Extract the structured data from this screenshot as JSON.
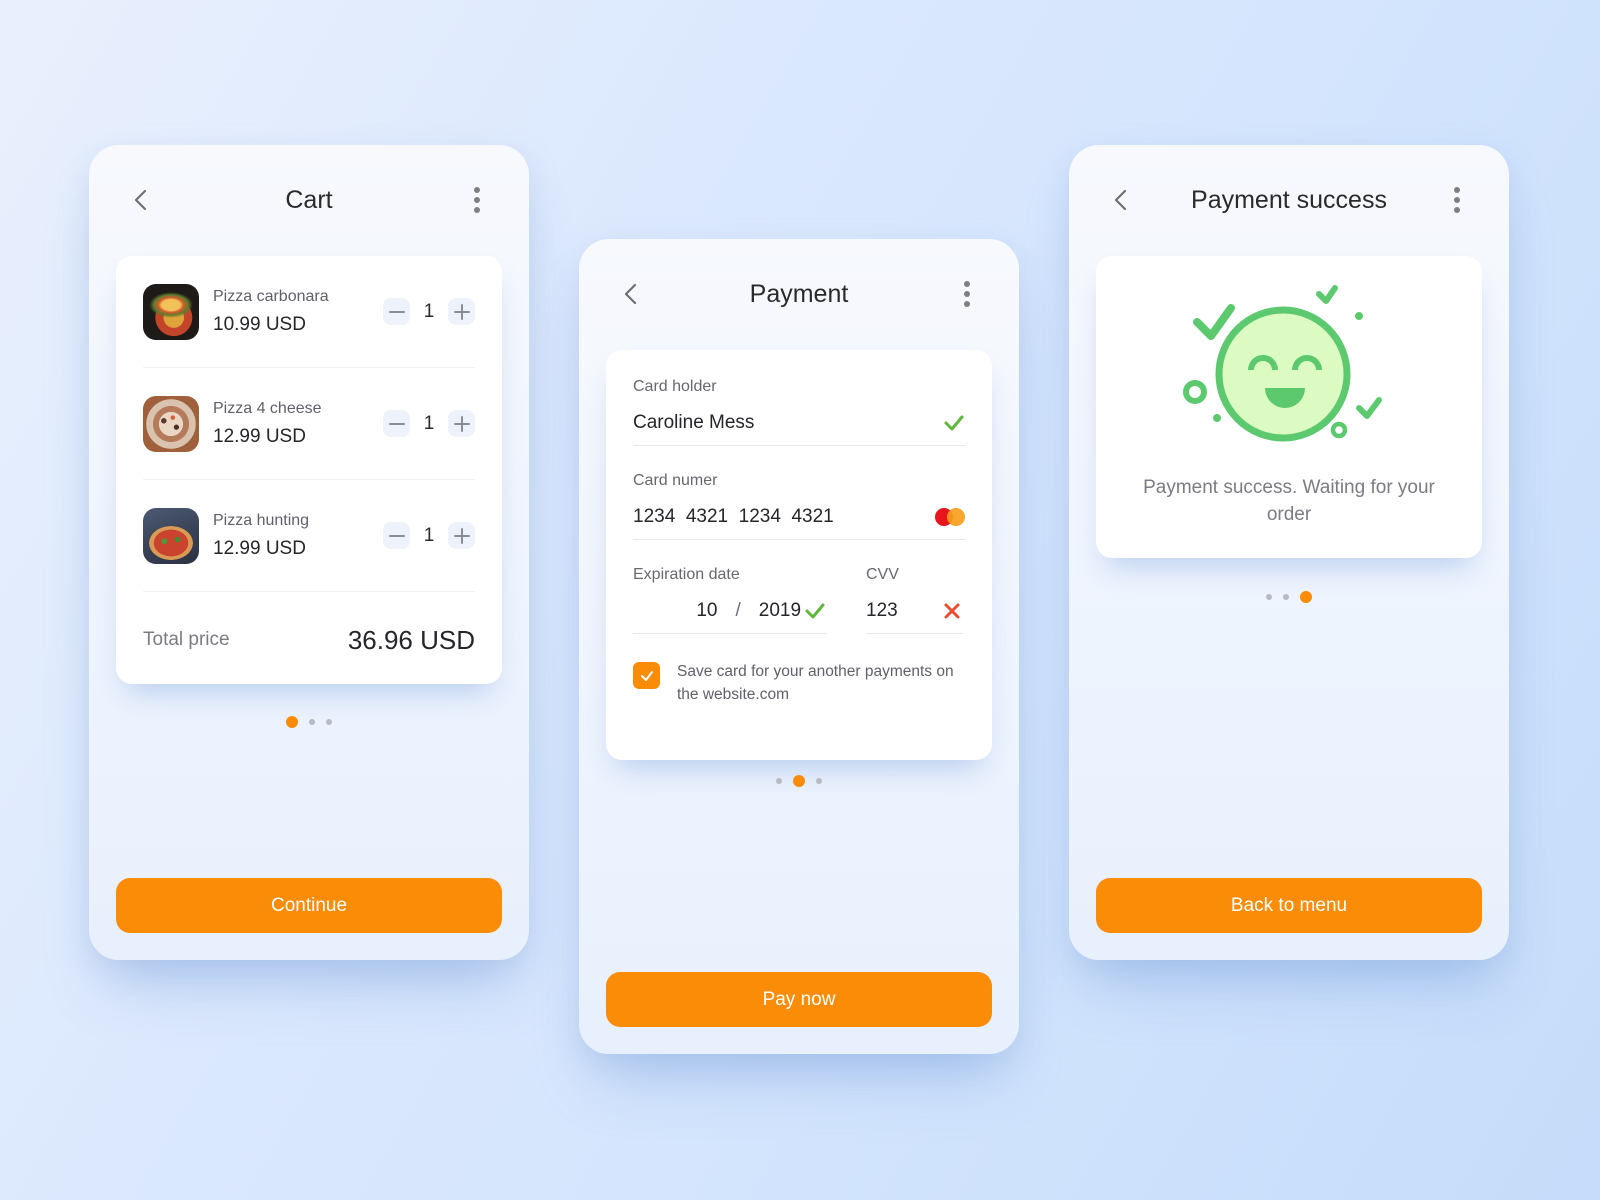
{
  "theme": {
    "accent": "#fb8c08",
    "success": "#5cc96f",
    "error": "#ea4b35",
    "mastercard_red": "#e8151f",
    "mastercard_orange": "#f79e1b"
  },
  "cart": {
    "title": "Cart",
    "back_icon": "chevron-left-icon",
    "menu_icon": "more-vertical-icon",
    "items": [
      {
        "name": "Pizza carbonara",
        "price": "10.99 USD",
        "quantity": "1",
        "thumbnail": "pizza-carbonara-photo"
      },
      {
        "name": "Pizza 4 cheese",
        "price": "12.99 USD",
        "quantity": "1",
        "thumbnail": "pizza-4-cheese-photo"
      },
      {
        "name": "Pizza hunting",
        "price": "12.99 USD",
        "quantity": "1",
        "thumbnail": "pizza-hunting-photo"
      }
    ],
    "total_label": "Total price",
    "total_value": "36.96 USD",
    "pager": {
      "pages": 3,
      "active": 1
    },
    "continue_label": "Continue"
  },
  "payment": {
    "title": "Payment",
    "card_holder": {
      "label": "Card holder",
      "value": "Caroline Mess",
      "status": "valid"
    },
    "card_number": {
      "label": "Card numer",
      "value": "1234  4321  1234  4321",
      "brand": "mastercard"
    },
    "expiration": {
      "label": "Expiration date",
      "month": "10",
      "separator": "/",
      "year": "2019",
      "status": "valid"
    },
    "cvv": {
      "label": "CVV",
      "value": "123",
      "status": "invalid"
    },
    "save_card": {
      "checked": true,
      "label": "Save card for your another payments on the website.com"
    },
    "pager": {
      "pages": 3,
      "active": 2
    },
    "pay_label": "Pay now"
  },
  "success": {
    "title": "Payment success",
    "illustration": "happy-face-icon",
    "message": "Payment success. Waiting for your order",
    "pager": {
      "pages": 3,
      "active": 3
    },
    "back_label": "Back to menu"
  }
}
